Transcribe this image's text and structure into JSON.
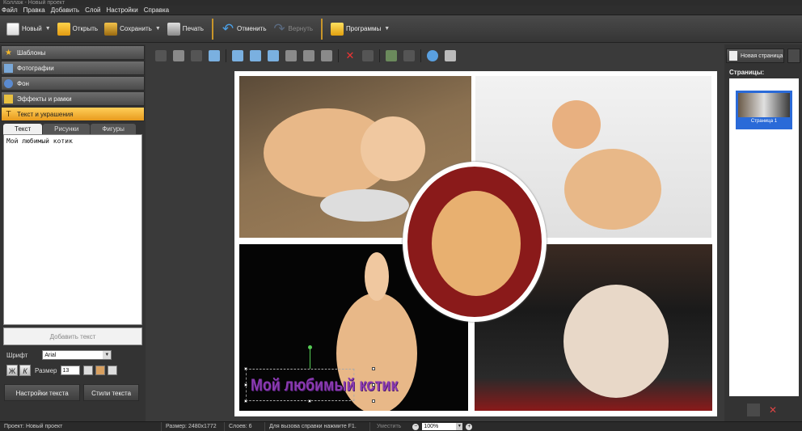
{
  "window": {
    "title": "Коллаж - Новый проект"
  },
  "menu": [
    "Файл",
    "Правка",
    "Добавить",
    "Слой",
    "Настройки",
    "Справка"
  ],
  "toolbar": {
    "new": "Новый",
    "open": "Открыть",
    "save": "Сохранить",
    "print": "Печать",
    "undo": "Отменить",
    "redo": "Вернуть",
    "programs": "Программы"
  },
  "left_panel": {
    "categories": [
      "Шаблоны",
      "Фотографии",
      "Фон",
      "Эффекты и рамки",
      "Текст и украшения"
    ],
    "tabs": [
      "Текст",
      "Рисунки",
      "Фигуры"
    ],
    "text_value": "Мой любимый котик",
    "add_text_button": "Добавить текст",
    "font_label": "Шрифт",
    "font_value": "Arial",
    "bold": "Ж",
    "italic": "К",
    "size_label": "Размер",
    "size_value": "13",
    "text_settings_button": "Настройки текста",
    "text_styles_button": "Стили текста"
  },
  "canvas": {
    "overlay_text": "Мой любимый котик"
  },
  "right_panel": {
    "new_page_button": "Новая страница",
    "pages_label": "Страницы:",
    "page_thumb_label": "Страница 1"
  },
  "status": {
    "project": "Проект:  Новый проект",
    "size": "Размер:  2480x1772",
    "layers": "Слоев:  6",
    "help": "Для вызова справки нажмите F1.",
    "fit": "Уместить",
    "zoom": "100%"
  },
  "colors": {
    "accent": "#e89a1c",
    "selection": "#2a6ad8",
    "overlay_text": "#8a3ab0"
  }
}
